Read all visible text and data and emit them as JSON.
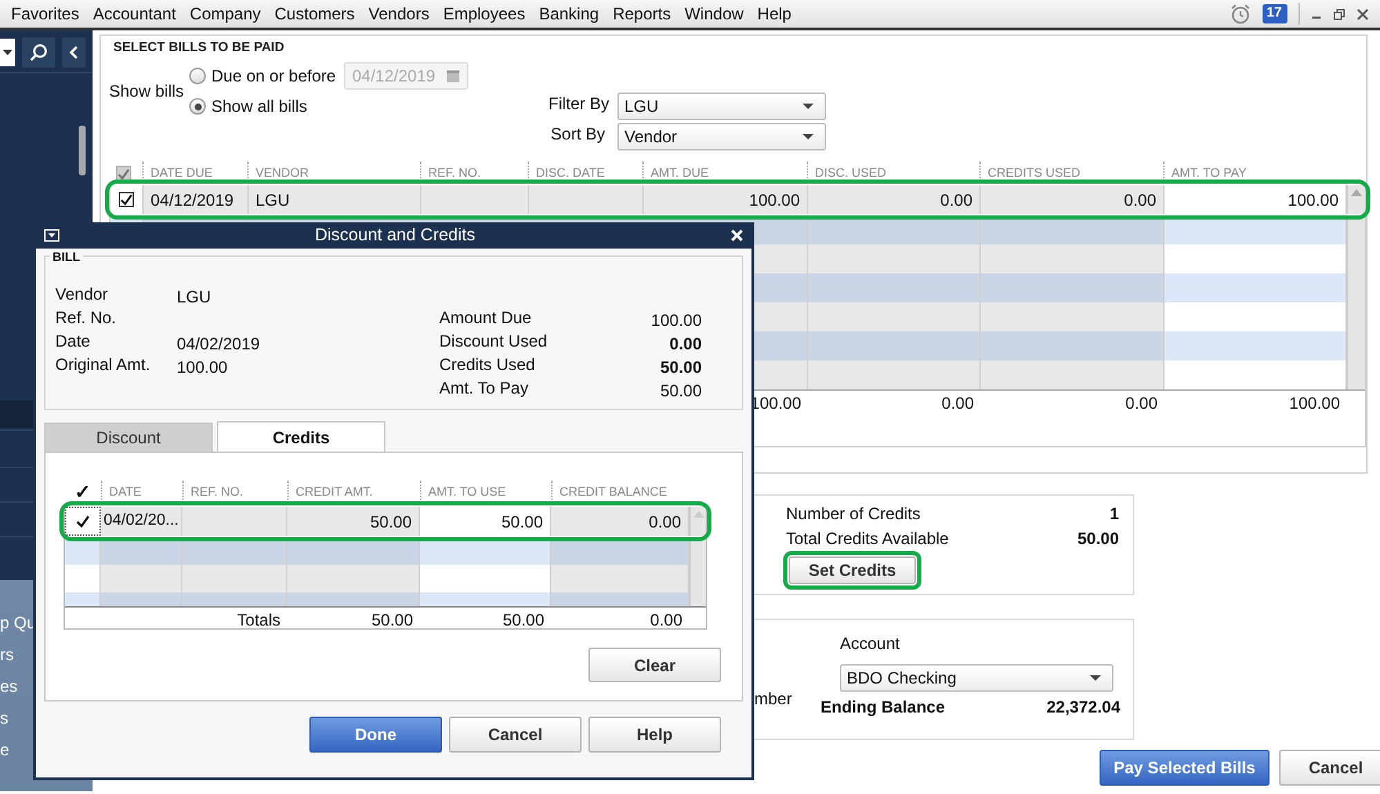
{
  "menu_bar": {
    "items": [
      "Favorites",
      "Accountant",
      "Company",
      "Customers",
      "Vendors",
      "Employees",
      "Banking",
      "Reports",
      "Window",
      "Help"
    ],
    "reminder_count": "17"
  },
  "sidebar": {
    "items": [
      "p Qu",
      "rs",
      "es",
      "s",
      "e"
    ]
  },
  "bills": {
    "title": "SELECT BILLS TO BE PAID",
    "show_bills_label": "Show bills",
    "show_options": [
      {
        "label": "Due on or before",
        "selected": false
      },
      {
        "label": "Show all bills",
        "selected": true
      }
    ],
    "due_date": {
      "value": "04/12/2019",
      "disabled": true
    },
    "filter_by": {
      "label": "Filter By",
      "value": "LGU"
    },
    "sort_by": {
      "label": "Sort By",
      "value": "Vendor"
    },
    "header_checked": true,
    "columns": [
      "DATE DUE",
      "VENDOR",
      "REF. NO.",
      "DISC. DATE",
      "AMT. DUE",
      "DISC. USED",
      "CREDITS USED",
      "AMT. TO PAY"
    ],
    "rows": [
      {
        "checked": true,
        "highlighted": true,
        "cells": [
          "04/12/2019",
          "LGU",
          null,
          null,
          "100.00",
          "0.00",
          "0.00",
          "100.00"
        ]
      }
    ],
    "totals": [
      "100.00",
      "0.00",
      "0.00",
      "100.00"
    ]
  },
  "credits_panel": {
    "number_label": "Number of Credits",
    "number": "1",
    "total_label": "Total Credits Available",
    "total": "50.00",
    "set_button": {
      "label": "Set Credits",
      "highlighted": true
    }
  },
  "payment": {
    "number_label": "mber",
    "account_label": "Account",
    "account": "BDO Checking",
    "ending_balance_label": "Ending Balance",
    "ending_balance": "22,372.04"
  },
  "buttons": [
    {
      "label": "Pay Selected Bills",
      "primary": true
    },
    {
      "label": "Cancel",
      "primary": false
    }
  ],
  "dialog": {
    "title": "Discount and Credits",
    "bill": {
      "title": "BILL",
      "fields": [
        {
          "label": "Vendor",
          "value": "LGU"
        },
        {
          "label": "Ref. No."
        },
        {
          "label": "Date",
          "value": "04/02/2019"
        },
        {
          "label": "Original Amt.",
          "value": "100.00"
        }
      ],
      "summary": [
        {
          "label": "Amount Due",
          "value": "100.00",
          "bold": false
        },
        {
          "label": "Discount Used",
          "value": "0.00",
          "bold": true
        },
        {
          "label": "Credits Used",
          "value": "50.00",
          "bold": true
        },
        {
          "label": "Amt. To Pay",
          "value": "50.00",
          "bold": false
        }
      ]
    },
    "tabs": [
      {
        "label": "Discount",
        "selected": false
      },
      {
        "label": "Credits",
        "selected": true
      }
    ],
    "check_header": "✓",
    "columns": [
      "DATE",
      "REF. NO.",
      "CREDIT AMT.",
      "AMT. TO USE",
      "CREDIT BALANCE"
    ],
    "credits": [
      {
        "checked": true,
        "highlighted": true,
        "cells": [
          "04/02/20...",
          null,
          "50.00",
          "50.00",
          "0.00"
        ]
      }
    ],
    "totals_label": "Totals",
    "totals": [
      "50.00",
      "50.00",
      "0.00"
    ],
    "clear_button": "Clear",
    "buttons": [
      {
        "label": "Done",
        "primary": true
      },
      {
        "label": "Cancel",
        "primary": false
      },
      {
        "label": "Help",
        "primary": false
      }
    ]
  }
}
